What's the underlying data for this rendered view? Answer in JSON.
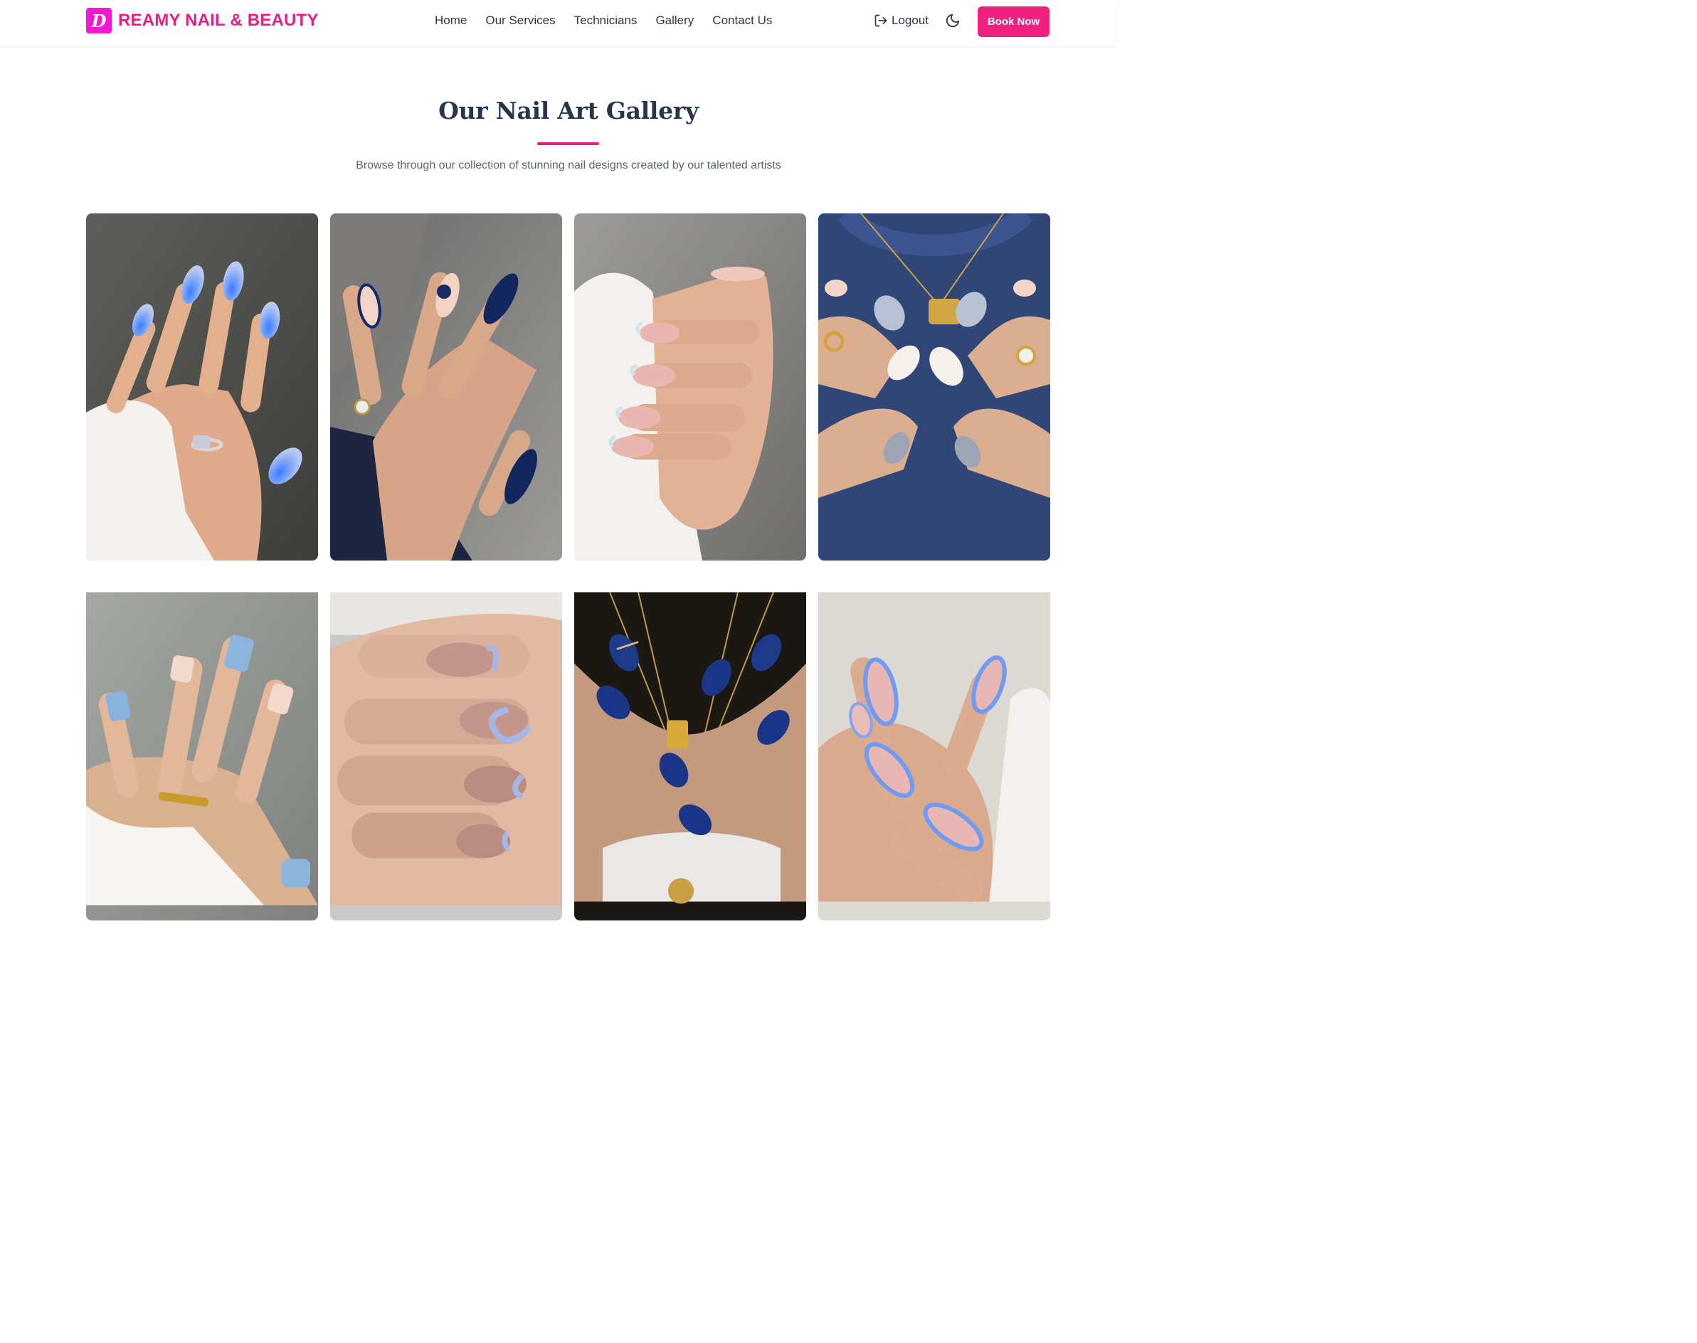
{
  "brand": {
    "logo_letter": "D",
    "name": "REAMY NAIL & BEAUTY",
    "color": "#ec1c84"
  },
  "nav": [
    "Home",
    "Our Services",
    "Technicians",
    "Gallery",
    "Contact Us"
  ],
  "header": {
    "logout_label": "Logout",
    "book_label": "Book Now",
    "theme_icon": "moon-icon",
    "logout_icon": "logout-icon"
  },
  "gallery": {
    "title": "Our Nail Art Gallery",
    "subtitle": "Browse through our collection of stunning nail designs created by our talented artists",
    "accent": "#f0207f"
  }
}
